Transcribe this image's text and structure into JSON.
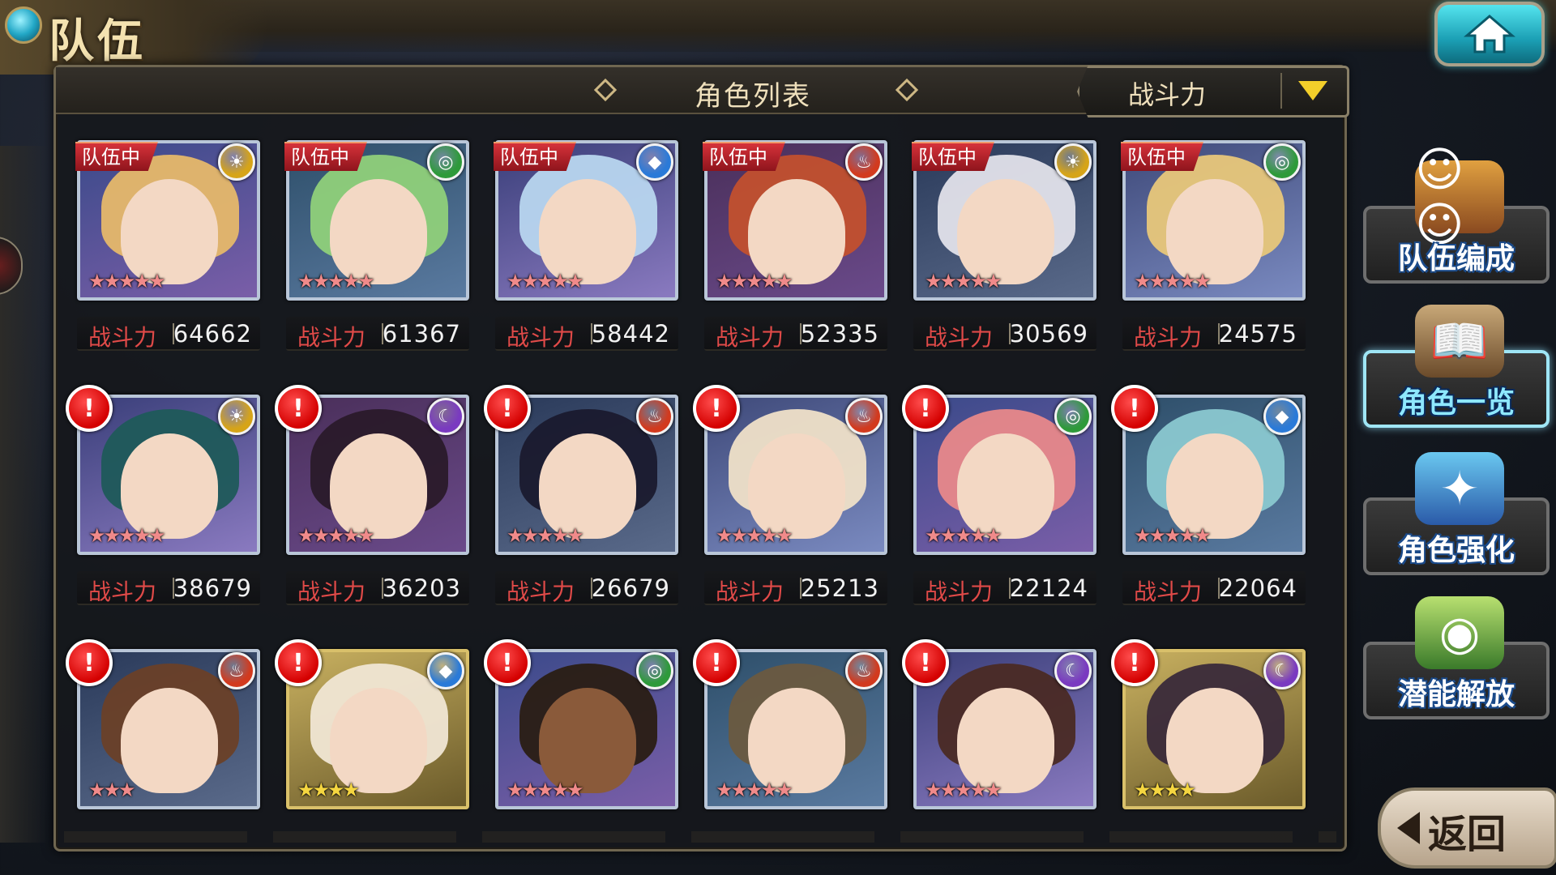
{
  "header": {
    "page_title": "队伍",
    "list_title": "角色列表",
    "sort_label": "战斗力"
  },
  "power_label": "战斗力",
  "team_badge": "队伍中",
  "alert_mark": "!",
  "colors": {
    "power_label": "#e04a48",
    "team_badge": "#c4222b",
    "alert": "#d40000",
    "sort_arrow": "#f3cf2a",
    "active_side": "#8ee8ff"
  },
  "rows": [
    {
      "cards": [
        {
          "element": "light-icon",
          "glyph": "☀",
          "in_team": true,
          "alert": false,
          "stars": "★★★★★",
          "power": "64662",
          "frame": "silver"
        },
        {
          "element": "wind-icon",
          "glyph": "◎",
          "in_team": true,
          "alert": false,
          "stars": "★★★★★",
          "power": "61367",
          "frame": "silver"
        },
        {
          "element": "water-icon",
          "glyph": "◆",
          "in_team": true,
          "alert": false,
          "stars": "★★★★★",
          "power": "58442",
          "frame": "silver"
        },
        {
          "element": "fire-icon",
          "glyph": "♨",
          "in_team": true,
          "alert": false,
          "stars": "★★★★★",
          "power": "52335",
          "frame": "silver"
        },
        {
          "element": "light-icon",
          "glyph": "☀",
          "in_team": true,
          "alert": false,
          "stars": "★★★★★",
          "power": "30569",
          "frame": "silver"
        },
        {
          "element": "wind-icon",
          "glyph": "◎",
          "in_team": true,
          "alert": false,
          "stars": "★★★★★",
          "power": "24575",
          "frame": "silver"
        }
      ]
    },
    {
      "cards": [
        {
          "element": "light-icon",
          "glyph": "☀",
          "in_team": false,
          "alert": true,
          "stars": "★★★★★",
          "power": "38679",
          "frame": "silver"
        },
        {
          "element": "dark-icon",
          "glyph": "☾",
          "in_team": false,
          "alert": true,
          "stars": "★★★★★",
          "power": "36203",
          "frame": "silver"
        },
        {
          "element": "fire-icon",
          "glyph": "♨",
          "in_team": false,
          "alert": true,
          "stars": "★★★★★",
          "power": "26679",
          "frame": "silver"
        },
        {
          "element": "fire-icon",
          "glyph": "♨",
          "in_team": false,
          "alert": true,
          "stars": "★★★★★",
          "power": "25213",
          "frame": "silver"
        },
        {
          "element": "wind-icon",
          "glyph": "◎",
          "in_team": false,
          "alert": true,
          "stars": "★★★★★",
          "power": "22124",
          "frame": "silver"
        },
        {
          "element": "water-icon",
          "glyph": "◆",
          "in_team": false,
          "alert": true,
          "stars": "★★★★★",
          "power": "22064",
          "frame": "silver"
        }
      ]
    },
    {
      "cards": [
        {
          "element": "fire-icon",
          "glyph": "♨",
          "in_team": false,
          "alert": true,
          "stars": "★★★",
          "power": "",
          "frame": "silver"
        },
        {
          "element": "water-icon",
          "glyph": "◆",
          "in_team": false,
          "alert": true,
          "stars": "★★★★",
          "power": "",
          "frame": "gold"
        },
        {
          "element": "wind-icon",
          "glyph": "◎",
          "in_team": false,
          "alert": true,
          "stars": "★★★★★",
          "power": "",
          "frame": "silver"
        },
        {
          "element": "fire-icon",
          "glyph": "♨",
          "in_team": false,
          "alert": true,
          "stars": "★★★★★",
          "power": "",
          "frame": "silver"
        },
        {
          "element": "dark-icon",
          "glyph": "☾",
          "in_team": false,
          "alert": true,
          "stars": "★★★★★",
          "power": "",
          "frame": "silver"
        },
        {
          "element": "dark-icon",
          "glyph": "☾",
          "in_team": false,
          "alert": true,
          "stars": "★★★★",
          "power": "",
          "frame": "gold"
        }
      ]
    }
  ],
  "side_menu": [
    {
      "label": "队伍编成",
      "icon": "team-members-icon",
      "active": false
    },
    {
      "label": "角色一览",
      "icon": "character-book-icon",
      "active": true
    },
    {
      "label": "角色强化",
      "icon": "enhance-card-icon",
      "active": false
    },
    {
      "label": "潜能解放",
      "icon": "potential-orb-icon",
      "active": false
    }
  ],
  "back_label": "返回"
}
